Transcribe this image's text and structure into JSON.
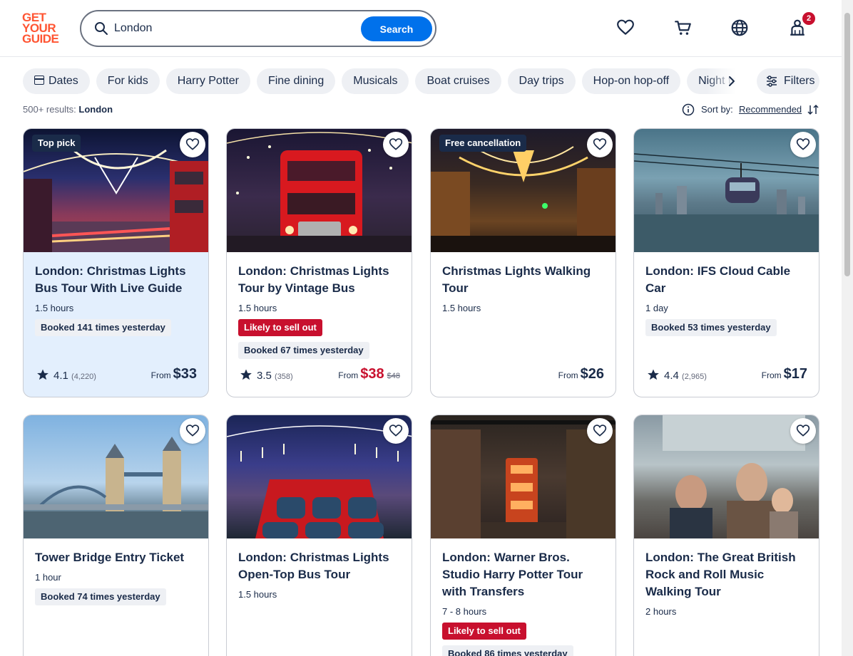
{
  "brand": {
    "logo_lines": [
      "GET",
      "YOUR",
      "GUIDE"
    ],
    "accent": "#ff5533",
    "primary": "#0071eb"
  },
  "search": {
    "value": "London",
    "button_label": "Search"
  },
  "header_icons": [
    "heart-icon",
    "cart-icon",
    "globe-icon",
    "profile-icon"
  ],
  "profile_badge": "2",
  "chips": [
    "Dates",
    "For kids",
    "Harry Potter",
    "Fine dining",
    "Musicals",
    "Boat cruises",
    "Day trips",
    "Hop-on hop-off",
    "Night to"
  ],
  "filters_label": "Filters",
  "results": {
    "count": "500+ results:",
    "query": "London"
  },
  "sort": {
    "label": "Sort by:",
    "value": "Recommended"
  },
  "cards": [
    {
      "tag": "Top pick",
      "title": "London: Christmas Lights Bus Tour With Live Guide",
      "duration": "1.5 hours",
      "booked": "Booked 141 times yesterday",
      "rating": "4.1",
      "reviews": "(4,220)",
      "from": "From",
      "price": "$33"
    },
    {
      "title": "London: Christmas Lights Tour by Vintage Bus",
      "duration": "1.5 hours",
      "alert": "Likely to sell out",
      "booked": "Booked 67 times yesterday",
      "rating": "3.5",
      "reviews": "(358)",
      "from": "From",
      "price": "$38",
      "old_price": "$48"
    },
    {
      "tag": "Free cancellation",
      "title": "Christmas Lights Walking Tour",
      "duration": "1.5 hours",
      "from": "From",
      "price": "$26"
    },
    {
      "title": "London: IFS Cloud Cable Car",
      "duration": "1 day",
      "booked": "Booked 53 times yesterday",
      "rating": "4.4",
      "reviews": "(2,965)",
      "from": "From",
      "price": "$17"
    },
    {
      "title": "Tower Bridge Entry Ticket",
      "duration": "1 hour",
      "booked": "Booked 74 times yesterday"
    },
    {
      "title": "London: Christmas Lights Open-Top Bus Tour",
      "duration": "1.5 hours"
    },
    {
      "title": "London: Warner Bros. Studio Harry Potter Tour with Transfers",
      "duration": "7 - 8 hours",
      "alert": "Likely to sell out",
      "booked": "Booked 86 times yesterday"
    },
    {
      "title": "London: The Great British Rock and Roll Music Walking Tour",
      "duration": "2 hours"
    }
  ]
}
